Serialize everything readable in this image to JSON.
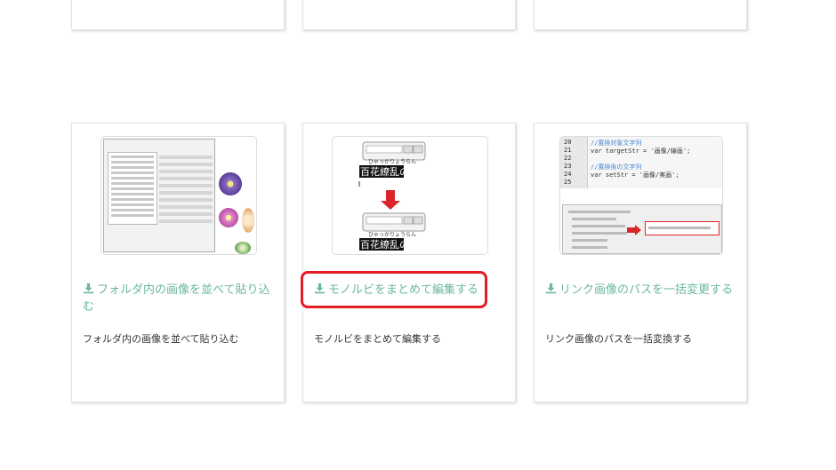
{
  "top_cards": [
    {},
    {},
    {}
  ],
  "cards": [
    {
      "link_label": "フォルダ内の画像を並べて貼り込む",
      "description": "フォルダ内の画像を並べて貼り込む"
    },
    {
      "link_label": "モノルビをまとめて編集する",
      "description": "モノルビをまとめて編集する",
      "thumb": {
        "ruby": "ひゃっかりょうらん",
        "kanji": "百花繚乱の"
      }
    },
    {
      "link_label": "リンク画像のパスを一括変更する",
      "description": "リンク画像のパスを一括変換する",
      "thumb": {
        "code_lines": [
          {
            "n": "20",
            "text": "//置換対象文字列"
          },
          {
            "n": "21",
            "text": "var targetStr = '画像/線画';"
          },
          {
            "n": "22",
            "text": ""
          },
          {
            "n": "23",
            "text": "//置換後の文字列"
          },
          {
            "n": "24",
            "text": "var setStr  = '画像/実画';"
          },
          {
            "n": "25",
            "text": ""
          }
        ]
      }
    }
  ],
  "colors": {
    "link": "#6ab89a",
    "highlight": "#e51c23",
    "arrow_red": "#d9262a"
  },
  "icons": {
    "download": "download-icon"
  }
}
